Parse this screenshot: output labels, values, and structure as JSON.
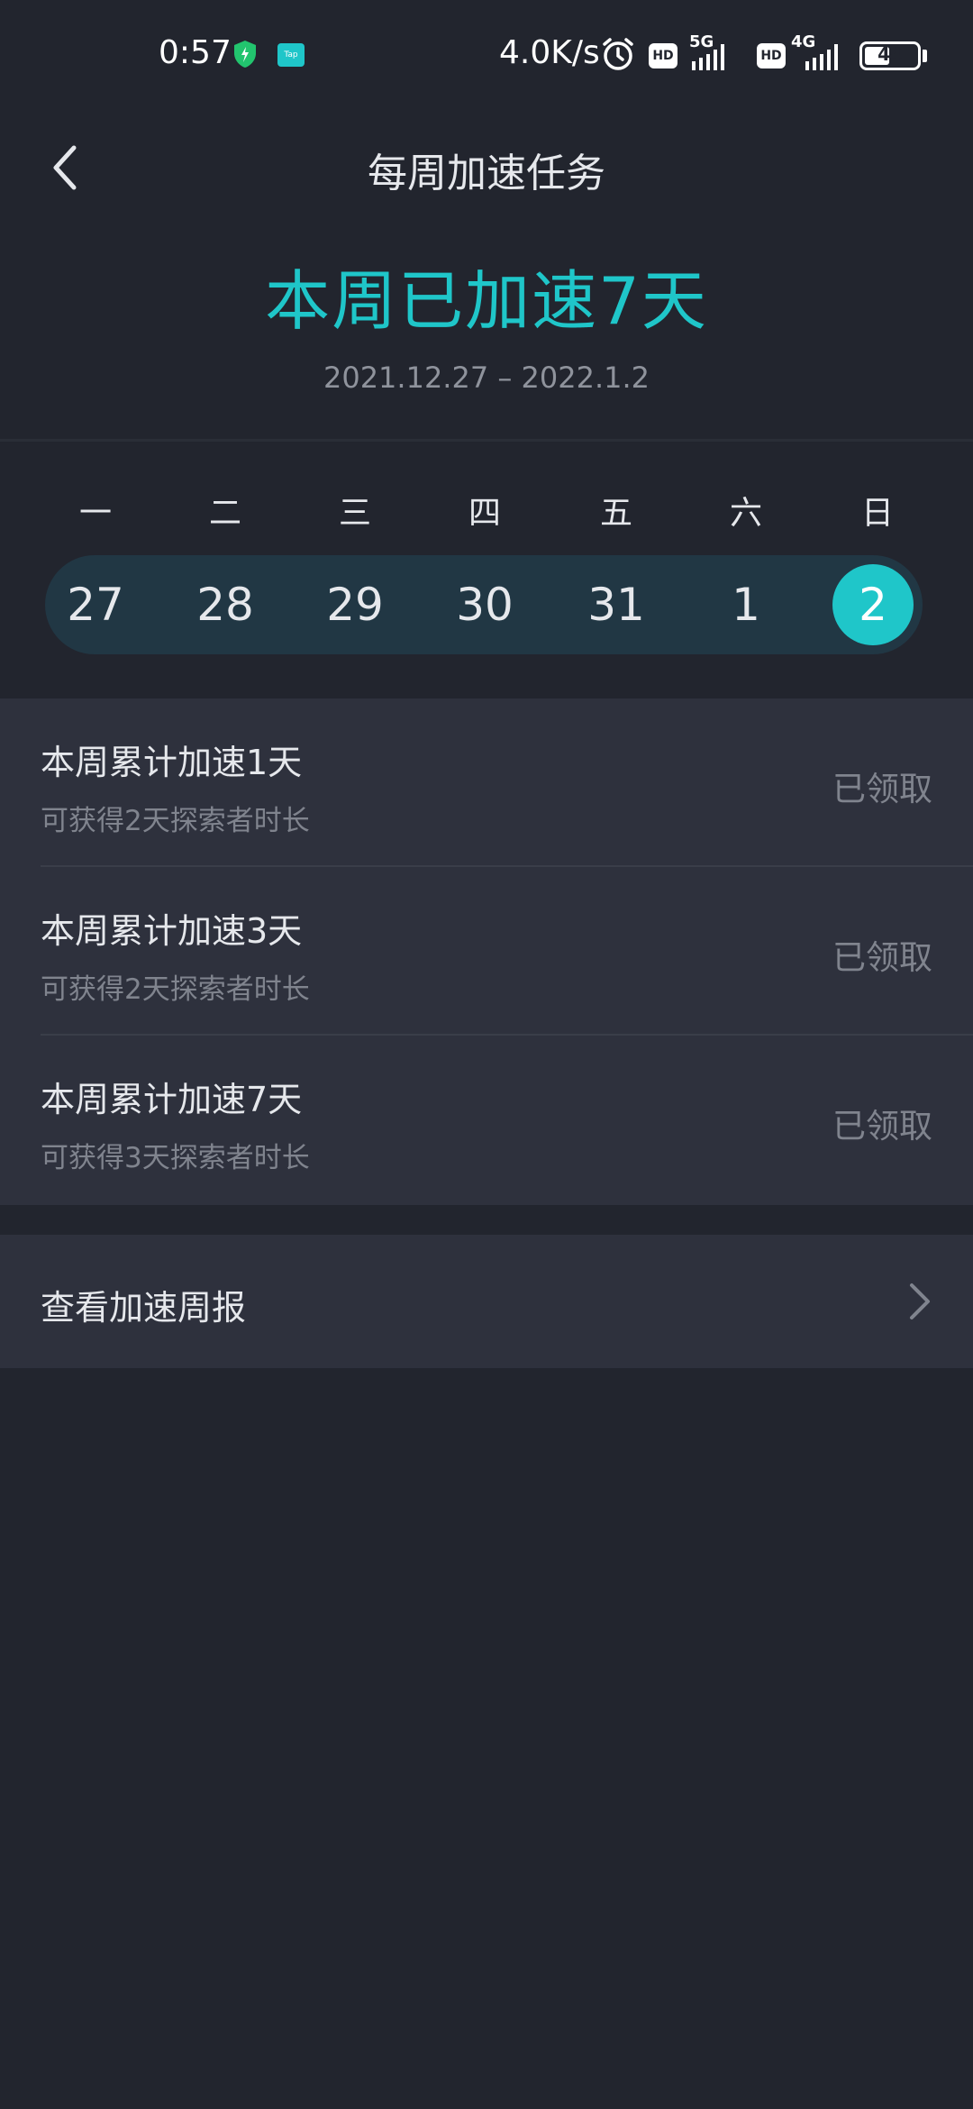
{
  "status_bar": {
    "time": "0:57",
    "tap_label": "Tap",
    "net_speed": "4.0K/s",
    "hd1": "HD",
    "net1": "5G",
    "hd2": "HD",
    "net2": "4G",
    "battery": "44"
  },
  "header": {
    "title": "每周加速任务"
  },
  "summary": {
    "headline": "本周已加速7天",
    "date_range": "2021.12.27 – 2022.1.2"
  },
  "week": {
    "weekdays": [
      "一",
      "二",
      "三",
      "四",
      "五",
      "六",
      "日"
    ],
    "dates": [
      "27",
      "28",
      "29",
      "30",
      "31",
      "1",
      "2"
    ]
  },
  "tasks": [
    {
      "title": "本周累计加速1天",
      "subtitle": "可获得2天探索者时长",
      "status": "已领取"
    },
    {
      "title": "本周累计加速3天",
      "subtitle": "可获得2天探索者时长",
      "status": "已领取"
    },
    {
      "title": "本周累计加速7天",
      "subtitle": "可获得3天探索者时长",
      "status": "已领取"
    }
  ],
  "report": {
    "label": "查看加速周报"
  },
  "colors": {
    "accent": "#1fc6c9",
    "background": "#22252e",
    "card": "#2e313d",
    "pill": "#213744"
  },
  "icons": {
    "back": "chevron-left-icon",
    "report": "chevron-right-icon",
    "shield": "shield-icon",
    "alarm": "alarm-icon"
  }
}
